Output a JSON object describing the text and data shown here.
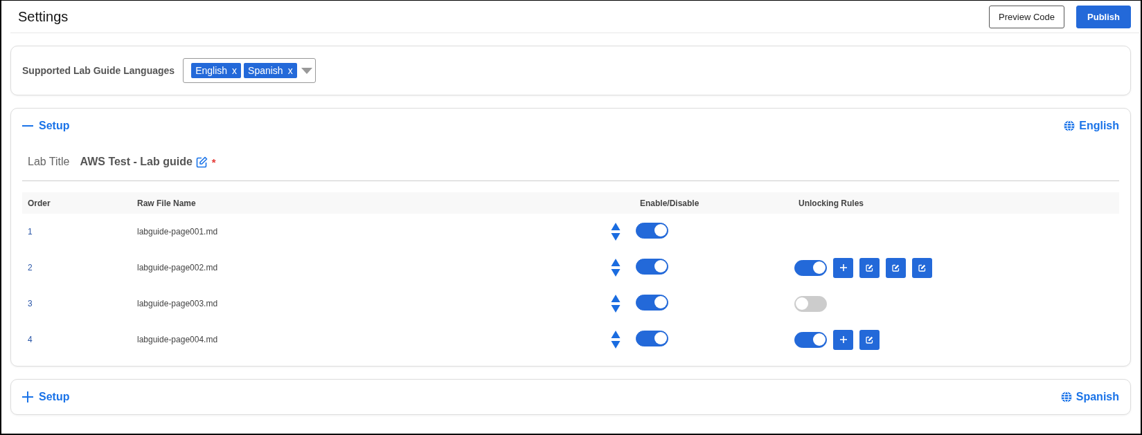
{
  "page": {
    "title": "Settings"
  },
  "actions": [
    {
      "label": "Preview Code",
      "kind": "outline"
    },
    {
      "label": "Publish",
      "kind": "primary"
    }
  ],
  "languages": {
    "label": "Supported Lab Guide Languages",
    "tags": [
      {
        "label": "English",
        "remove": "x"
      },
      {
        "label": "Spanish",
        "remove": "x"
      }
    ]
  },
  "sections": [
    {
      "title": "Setup",
      "expanded": true,
      "language": "English",
      "lab_title_label": "Lab Title",
      "lab_title": "AWS Test - Lab guide",
      "required_mark": "*",
      "columns": [
        "Order",
        "Raw File Name",
        "Enable/Disable",
        "Unlocking Rules"
      ],
      "rows": [
        {
          "order": "1",
          "file": "labguide-page001.md",
          "enabled": true
        },
        {
          "order": "2",
          "file": "labguide-page002.md",
          "enabled": true,
          "rules": {
            "on": true,
            "buttons": [
              {
                "kind": "add"
              },
              {
                "kind": "edit"
              },
              {
                "kind": "edit"
              },
              {
                "kind": "edit"
              }
            ]
          }
        },
        {
          "order": "3",
          "file": "labguide-page003.md",
          "enabled": true,
          "rules": {
            "on": false
          }
        },
        {
          "order": "4",
          "file": "labguide-page004.md",
          "enabled": true,
          "rules": {
            "on": true,
            "buttons": [
              {
                "kind": "add"
              },
              {
                "kind": "edit"
              }
            ]
          }
        }
      ]
    },
    {
      "title": "Setup",
      "expanded": false,
      "language": "Spanish"
    }
  ]
}
